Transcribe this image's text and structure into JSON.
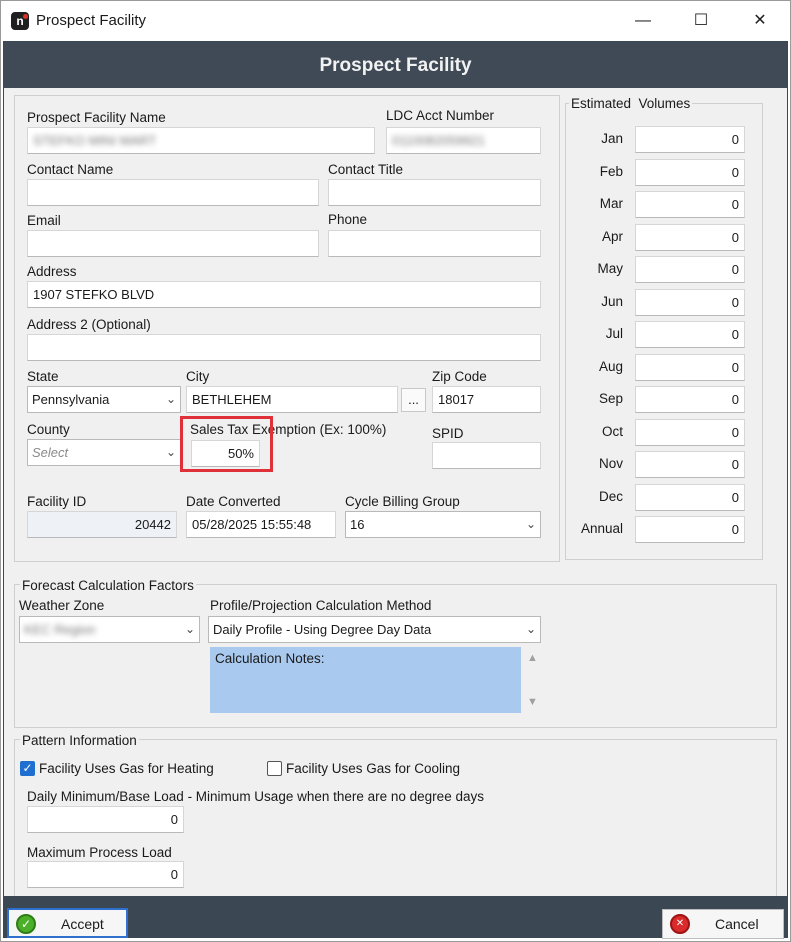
{
  "window": {
    "title": "Prospect Facility",
    "app_icon_glyph": "n",
    "minimize_glyph": "—",
    "maximize_glyph": "☐",
    "close_glyph": "✕"
  },
  "header": {
    "title": "Prospect Facility"
  },
  "facility": {
    "name_label": "Prospect Facility Name",
    "name_value": "STEFKO MINI MART",
    "ldc_label": "LDC Acct Number",
    "ldc_value": "0110082059921",
    "contact_name_label": "Contact Name",
    "contact_name_value": "",
    "contact_title_label": "Contact Title",
    "contact_title_value": "",
    "email_label": "Email",
    "email_value": "",
    "phone_label": "Phone",
    "phone_value": "",
    "address_label": "Address",
    "address_value": "1907 STEFKO BLVD",
    "address2_label": "Address 2 (Optional)",
    "address2_value": "",
    "state_label": "State",
    "state_value": "Pennsylvania",
    "city_label": "City",
    "city_value": "BETHLEHEM",
    "city_lookup": "...",
    "zip_label": "Zip Code",
    "zip_value": "18017",
    "county_label": "County",
    "county_placeholder": "Select",
    "tax_label": "Sales Tax Exemption (Ex: 100%)",
    "tax_value": "50%",
    "spid_label": "SPID",
    "spid_value": "",
    "facility_id_label": "Facility ID",
    "facility_id_value": "20442",
    "date_converted_label": "Date Converted",
    "date_converted_value": "05/28/2025 15:55:48",
    "cycle_label": "Cycle Billing Group",
    "cycle_value": "16"
  },
  "volumes": {
    "title": "Estimated  Volumes",
    "rows": [
      {
        "month": "Jan",
        "value": "0"
      },
      {
        "month": "Feb",
        "value": "0"
      },
      {
        "month": "Mar",
        "value": "0"
      },
      {
        "month": "Apr",
        "value": "0"
      },
      {
        "month": "May",
        "value": "0"
      },
      {
        "month": "Jun",
        "value": "0"
      },
      {
        "month": "Jul",
        "value": "0"
      },
      {
        "month": "Aug",
        "value": "0"
      },
      {
        "month": "Sep",
        "value": "0"
      },
      {
        "month": "Oct",
        "value": "0"
      },
      {
        "month": "Nov",
        "value": "0"
      },
      {
        "month": "Dec",
        "value": "0"
      },
      {
        "month": "Annual",
        "value": "0"
      }
    ]
  },
  "forecast": {
    "title": "Forecast Calculation Factors",
    "weather_label": "Weather Zone",
    "weather_value": "KEC Region",
    "method_label": "Profile/Projection Calculation Method",
    "method_value": "Daily Profile - Using Degree Day Data",
    "notes_label": "Calculation Notes:"
  },
  "pattern": {
    "title": "Pattern Information",
    "heating_label": "Facility Uses Gas for Heating",
    "heating_checked": true,
    "cooling_label": "Facility Uses Gas for Cooling",
    "cooling_checked": false,
    "base_load_label": "Daily Minimum/Base Load - Minimum Usage when there are no degree days",
    "base_load_value": "0",
    "max_load_label": "Maximum Process Load",
    "max_load_value": "0"
  },
  "footer": {
    "accept_label": "Accept",
    "cancel_label": "Cancel"
  },
  "colors": {
    "header_bg": "#3f4a56",
    "panel_bg": "#f0f0f0",
    "highlight": "#e0313a",
    "notes_bg": "#a9c9ef",
    "accept_icon": "#4caf2a",
    "cancel_icon": "#d92b2b"
  }
}
